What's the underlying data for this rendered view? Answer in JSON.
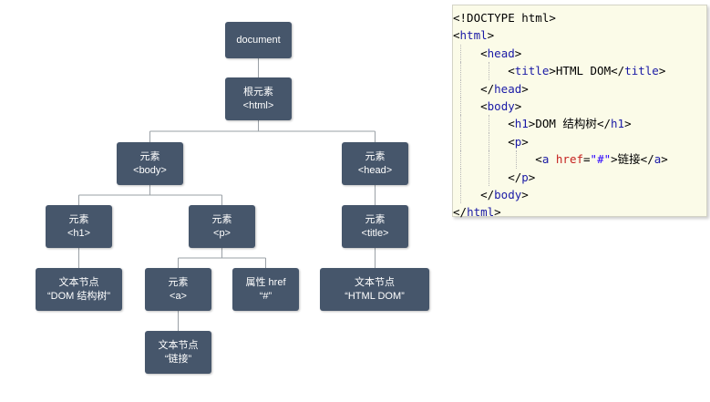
{
  "tree": {
    "document": {
      "line1": "document"
    },
    "html": {
      "line1": "根元素",
      "line2": "<html>"
    },
    "body": {
      "line1": "元素",
      "line2": "<body>"
    },
    "head": {
      "line1": "元素",
      "line2": "<head>"
    },
    "h1": {
      "line1": "元素",
      "line2": "<h1>"
    },
    "p": {
      "line1": "元素",
      "line2": "<p>"
    },
    "title": {
      "line1": "元素",
      "line2": "<title>"
    },
    "text_dom": {
      "line1": "文本节点",
      "line2": "“DOM 结构树”"
    },
    "a": {
      "line1": "元素",
      "line2": "<a>"
    },
    "href": {
      "line1": "属性 href",
      "line2": "“#”"
    },
    "text_html": {
      "line1": "文本节点",
      "line2": "“HTML DOM”"
    },
    "text_link": {
      "line1": "文本节点",
      "line2": "“链接”"
    }
  },
  "code": {
    "doctype": "<!DOCTYPE html>",
    "html_open": "html",
    "head_open": "head",
    "title_tag": "title",
    "title_text": "HTML DOM",
    "head_close": "head",
    "body_open": "body",
    "h1_tag": "h1",
    "h1_text": "DOM 结构树",
    "p_tag": "p",
    "a_tag": "a",
    "href_attr": "href",
    "href_value": "\"#\"",
    "a_text": "链接",
    "body_close": "body",
    "html_close": "html"
  },
  "colors": {
    "node_bg": "#46566b",
    "node_text": "#ffffff",
    "code_bg": "#fbfbe8",
    "tag_color": "#1a1aa6",
    "attr_color": "#c5221f",
    "string_color": "#2a00ff"
  }
}
